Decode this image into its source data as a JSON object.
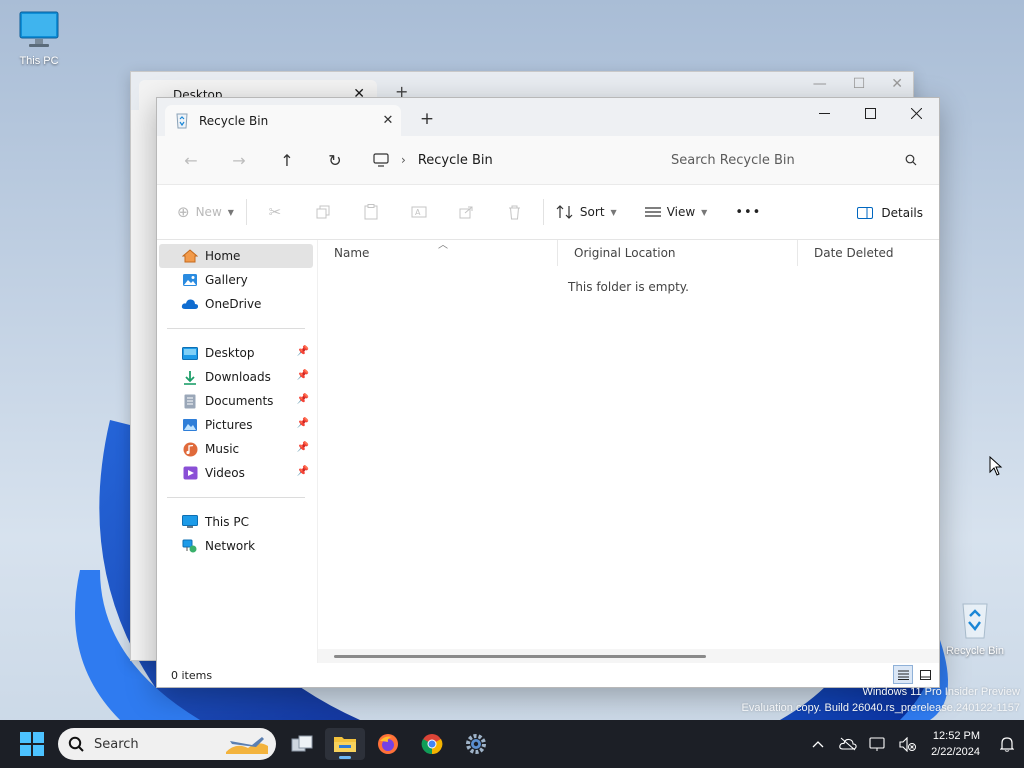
{
  "desktop": {
    "icons": [
      {
        "label": "This PC"
      },
      {
        "label": "Recycle Bin"
      }
    ],
    "watermark": [
      "Windows 11 Pro Insider Preview",
      "Evaluation copy. Build 26040.rs_prerelease.240122-1157"
    ]
  },
  "back_window": {
    "tab_label": "Desktop"
  },
  "window": {
    "tab_label": "Recycle Bin",
    "address": {
      "breadcrumb": "Recycle Bin",
      "search_placeholder": "Search Recycle Bin"
    },
    "command_bar": {
      "new_label": "New",
      "sort_label": "Sort",
      "view_label": "View",
      "more_label": "•••",
      "details_label": "Details"
    },
    "navigation": {
      "group1": [
        {
          "label": "Home"
        },
        {
          "label": "Gallery"
        },
        {
          "label": "OneDrive"
        }
      ],
      "group2": [
        {
          "label": "Desktop"
        },
        {
          "label": "Downloads"
        },
        {
          "label": "Documents"
        },
        {
          "label": "Pictures"
        },
        {
          "label": "Music"
        },
        {
          "label": "Videos"
        }
      ],
      "group3": [
        {
          "label": "This PC"
        },
        {
          "label": "Network"
        }
      ]
    },
    "columns": [
      "Name",
      "Original Location",
      "Date Deleted"
    ],
    "empty_message": "This folder is empty.",
    "status": "0 items"
  },
  "taskbar": {
    "search_label": "Search",
    "time": "12:52 PM",
    "date": "2/22/2024"
  },
  "colors": {
    "accent": "#0067c0",
    "folder": "#f3c23c",
    "taskbar": "#1c1f26"
  }
}
